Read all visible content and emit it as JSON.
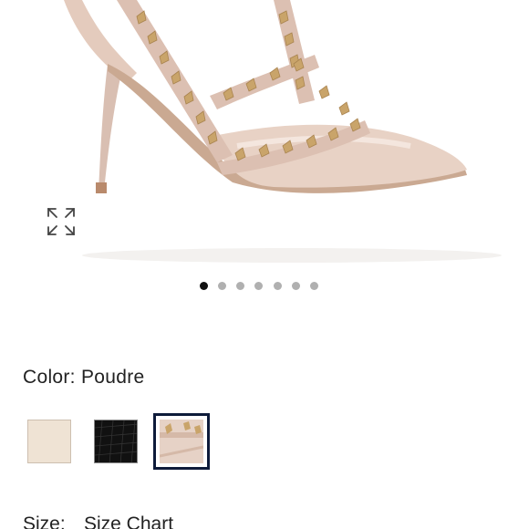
{
  "gallery": {
    "image_description_icon": "pointed-toe-studded-pump",
    "expand_icon": "expand-arrows-icon",
    "slides": [
      1,
      2,
      3,
      4,
      5,
      6,
      7
    ],
    "active_slide": 1
  },
  "color": {
    "label": "Color:",
    "value": "Poudre",
    "swatches": [
      {
        "name": "cream",
        "hex": "#efe3d4"
      },
      {
        "name": "black",
        "hex": "#111111"
      },
      {
        "name": "poudre",
        "hex": "#e6d2c6",
        "selected": true
      }
    ]
  },
  "size": {
    "label": "Size:",
    "chart_link": "Size Chart"
  }
}
